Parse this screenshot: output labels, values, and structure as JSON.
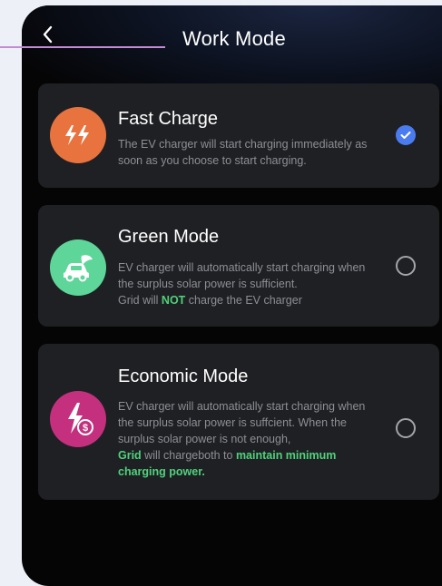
{
  "header": {
    "title": "Work Mode",
    "back_icon": "chevron-left-icon"
  },
  "modes": [
    {
      "title": "Fast Charge",
      "icon": "double-bolt-icon",
      "icon_color": "#e8733e",
      "selected": true,
      "desc": "The EV charger will start charging immediately as soon as you choose to start charging."
    },
    {
      "title": "Green Mode",
      "icon": "eco-car-icon",
      "icon_color": "#5ed69a",
      "selected": false,
      "desc_line1": "EV charger will automatically start charging when the surplus solar power is sufficient.",
      "desc_pre": "Grid will ",
      "desc_highlight": "NOT",
      "desc_post": " charge the EV charger"
    },
    {
      "title": "Economic Mode",
      "icon": "bolt-dollar-icon",
      "icon_color": "#c4307e",
      "selected": false,
      "desc_line1": "EV charger will automatically start charging when the surplus solar power is suffcient. When the surplus solar power is not enough,",
      "desc_hl1": "Grid",
      "desc_mid": " will chargeboth to ",
      "desc_hl2": "maintain minimum charging power."
    }
  ],
  "colors": {
    "accent_blue": "#4a7cf0",
    "highlight_green": "#4fd27c",
    "card_bg": "#1f2023"
  }
}
